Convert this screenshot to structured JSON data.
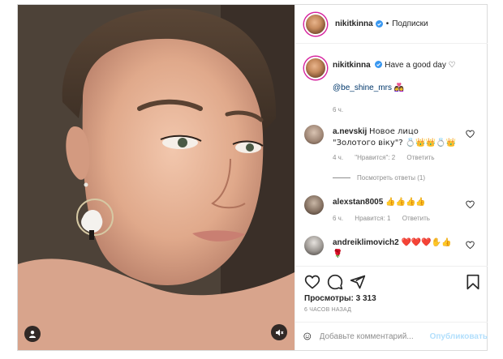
{
  "post": {
    "photo_alt": "",
    "icons": {
      "user_tag": "person-icon",
      "audio": "speaker-muted-icon"
    }
  },
  "header": {
    "username": "nikitkinna",
    "separator": "•",
    "follow_label": "Подписки"
  },
  "caption": {
    "username": "nikitkinna",
    "text": "Have a good day ♡",
    "mention": "@be_shine_mrs",
    "mention_emoji": "👩‍❤️‍👩",
    "time": "6 ч."
  },
  "comments": [
    {
      "username": "a.nevskij",
      "text": "Новое лицо \"Золотого віку\"? 💍👑👑💍👑",
      "time": "4 ч.",
      "likes": "\"Нравится\": 2",
      "reply": "Ответить",
      "view_replies": "Посмотреть ответы (1)"
    },
    {
      "username": "alexstan8005",
      "text": "👍👍👍👍",
      "time": "6 ч.",
      "likes": "Нравится: 1",
      "reply": "Ответить"
    },
    {
      "username": "andreiklimovich2",
      "text": "❤️❤️❤️✋👍",
      "text2": "🌹"
    }
  ],
  "actions": {
    "icons": [
      "heart-icon",
      "comment-icon",
      "share-icon",
      "save-icon"
    ],
    "views": "Просмотры: 3 313",
    "time": "6 ЧАСОВ НАЗАД"
  },
  "composer": {
    "placeholder": "Добавьте комментарий...",
    "publish_label": "Опубликовать"
  },
  "colors": {
    "link": "#00376b",
    "meta": "#8e8e8e",
    "publish_disabled": "#b2dffc",
    "verified": "#3897f0"
  }
}
